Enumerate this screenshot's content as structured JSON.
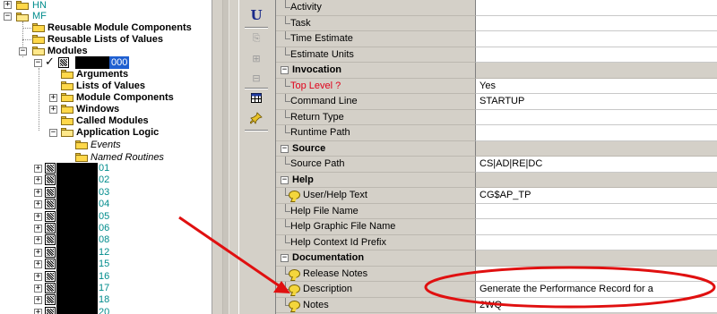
{
  "tree": {
    "top_nodes": [
      {
        "label": "HN"
      },
      {
        "label": "MF"
      }
    ],
    "children": [
      {
        "label": "Reusable Module Components"
      },
      {
        "label": "Reusable Lists of Values"
      },
      {
        "label": "Modules"
      }
    ],
    "selected_module_suffix": "000",
    "module_children": [
      {
        "label": "Arguments"
      },
      {
        "label": "Lists of Values"
      },
      {
        "label": "Module Components"
      },
      {
        "label": "Windows"
      },
      {
        "label": "Called Modules"
      },
      {
        "label": "Application Logic"
      }
    ],
    "logic_children": [
      {
        "label": "Events"
      },
      {
        "label": "Named Routines"
      }
    ],
    "module_suffixes": [
      "01",
      "02",
      "03",
      "04",
      "05",
      "06",
      "08",
      "12",
      "15",
      "16",
      "17",
      "18",
      "20"
    ]
  },
  "toolbar": {
    "u_label": "U",
    "icons": [
      "underline-icon",
      "copy-properties-icon",
      "add-row-icon",
      "remove-row-icon",
      "table-icon",
      "pin-icon"
    ]
  },
  "palette": {
    "rows": [
      {
        "kind": "prop",
        "name": "Activity",
        "value": ""
      },
      {
        "kind": "prop",
        "name": "Task",
        "value": ""
      },
      {
        "kind": "prop",
        "name": "Time Estimate",
        "value": ""
      },
      {
        "kind": "prop",
        "name": "Estimate Units",
        "value": ""
      },
      {
        "kind": "section",
        "name": "Invocation",
        "value": ""
      },
      {
        "kind": "prop",
        "name": "Top Level ?",
        "value": "Yes",
        "mandatory": true
      },
      {
        "kind": "prop",
        "name": "Command Line",
        "value": "STARTUP"
      },
      {
        "kind": "prop",
        "name": "Return Type",
        "value": ""
      },
      {
        "kind": "prop",
        "name": "Runtime Path",
        "value": ""
      },
      {
        "kind": "section",
        "name": "Source",
        "value": ""
      },
      {
        "kind": "prop",
        "name": "Source Path",
        "value": "CS|AD|RE|DC"
      },
      {
        "kind": "section",
        "name": "Help",
        "value": ""
      },
      {
        "kind": "prop",
        "name": "User/Help Text",
        "value": "CG$AP_TP",
        "icon": true
      },
      {
        "kind": "prop",
        "name": "Help File Name",
        "value": ""
      },
      {
        "kind": "prop",
        "name": "Help Graphic File Name",
        "value": ""
      },
      {
        "kind": "prop",
        "name": "Help Context Id Prefix",
        "value": ""
      },
      {
        "kind": "section",
        "name": "Documentation",
        "value": ""
      },
      {
        "kind": "prop",
        "name": "Release Notes",
        "value": "",
        "icon": true
      },
      {
        "kind": "prop",
        "name": "Description",
        "value": "Generate the Performance Record for a",
        "icon": true
      },
      {
        "kind": "prop",
        "name": "Notes",
        "value": "2WQ",
        "icon": true
      }
    ]
  },
  "colors": {
    "annotation_red": "#e01010",
    "mandatory_red": "#e0001a",
    "panel_gray": "#d4d0c8",
    "teal_text": "#008c8c"
  }
}
